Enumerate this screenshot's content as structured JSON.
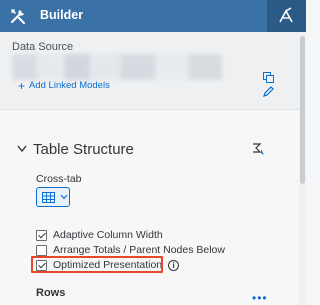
{
  "header": {
    "title": "Builder",
    "builder_icon": "tools-icon",
    "right_icon": "designer-icon"
  },
  "datasource": {
    "label": "Data Source",
    "add_linked_label": "Add Linked Models",
    "icons": [
      "copy-icon",
      "edit-icon"
    ]
  },
  "table_structure": {
    "title": "Table Structure",
    "crosstab_label": "Cross-tab",
    "options": [
      {
        "label": "Adaptive Column Width",
        "checked": true
      },
      {
        "label": "Arrange Totals / Parent Nodes Below",
        "checked": false
      },
      {
        "label": "Optimized Presentation",
        "checked": true
      }
    ],
    "rows_label": "Rows",
    "more_label": "•••"
  },
  "colors": {
    "header": "#3a72a7",
    "accent": "#0a6ed1",
    "highlight": "#e8472a"
  }
}
